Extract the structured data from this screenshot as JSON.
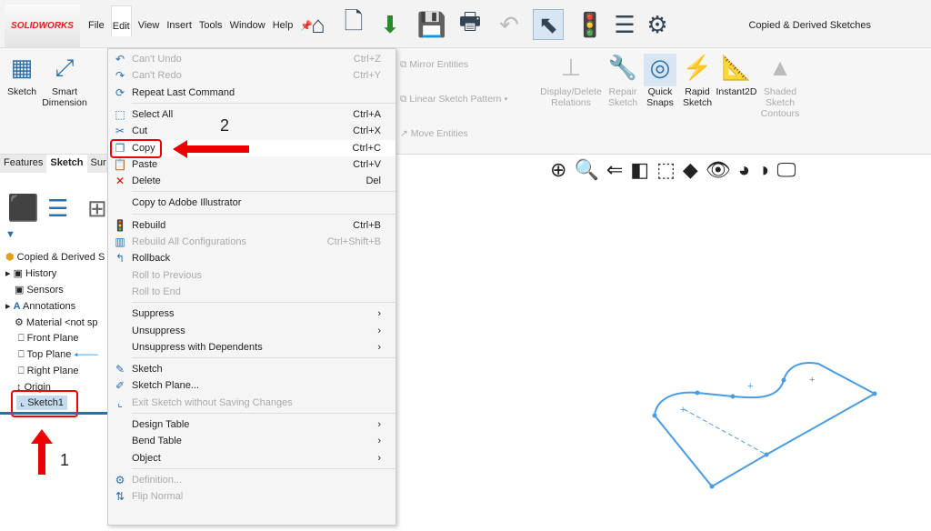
{
  "app": {
    "logo": "SOLIDWORKS",
    "document_title": "Copied & Derived Sketches"
  },
  "menubar": [
    "File",
    "Edit",
    "View",
    "Insert",
    "Tools",
    "Window",
    "Help"
  ],
  "ribbon": {
    "items": [
      {
        "label": "Sketch",
        "disabled": false
      },
      {
        "label": "Smart Dimension",
        "disabled": false
      },
      {
        "label": "Mirror Entities",
        "disabled": true
      },
      {
        "label": "Linear Sketch Pattern",
        "disabled": true
      },
      {
        "label": "Move Entities",
        "disabled": true
      },
      {
        "label": "Display/Delete Relations",
        "disabled": true
      },
      {
        "label": "Repair Sketch",
        "disabled": true
      },
      {
        "label": "Quick Snaps",
        "disabled": false
      },
      {
        "label": "Rapid Sketch",
        "disabled": false
      },
      {
        "label": "Instant2D",
        "disabled": false
      },
      {
        "label": "Shaded Sketch Contours",
        "disabled": true
      }
    ]
  },
  "tabs": [
    "Features",
    "Sketch",
    "Sur"
  ],
  "tree": {
    "root": "Copied & Derived S",
    "items": [
      "History",
      "Sensors",
      "Annotations",
      "Material <not sp",
      "Front Plane",
      "Top Plane",
      "Right Plane",
      "Origin",
      "Sketch1"
    ]
  },
  "edit_menu": [
    {
      "label": "Can't Undo",
      "shortcut": "Ctrl+Z",
      "disabled": true,
      "icon": "undo"
    },
    {
      "label": "Can't Redo",
      "shortcut": "Ctrl+Y",
      "disabled": true,
      "icon": "redo"
    },
    {
      "label": "Repeat Last Command",
      "shortcut": "",
      "disabled": false,
      "icon": "repeat"
    },
    {
      "label": "Select All",
      "shortcut": "Ctrl+A",
      "disabled": false,
      "icon": "select"
    },
    {
      "label": "Cut",
      "shortcut": "Ctrl+X",
      "disabled": false,
      "icon": "scissors"
    },
    {
      "label": "Copy",
      "shortcut": "Ctrl+C",
      "disabled": false,
      "icon": "copy"
    },
    {
      "label": "Paste",
      "shortcut": "Ctrl+V",
      "disabled": false,
      "icon": "paste"
    },
    {
      "label": "Delete",
      "shortcut": "Del",
      "disabled": false,
      "icon": "delete"
    },
    {
      "label": "Copy to Adobe Illustrator",
      "shortcut": "",
      "disabled": false,
      "icon": ""
    },
    {
      "label": "Rebuild",
      "shortcut": "Ctrl+B",
      "disabled": false,
      "icon": "traffic-light"
    },
    {
      "label": "Rebuild All Configurations",
      "shortcut": "Ctrl+Shift+B",
      "disabled": true,
      "icon": "rebuild-all"
    },
    {
      "label": "Rollback",
      "shortcut": "",
      "disabled": false,
      "icon": "rollback"
    },
    {
      "label": "Roll to Previous",
      "shortcut": "",
      "disabled": true,
      "icon": ""
    },
    {
      "label": "Roll to End",
      "shortcut": "",
      "disabled": true,
      "icon": ""
    },
    {
      "label": "Suppress",
      "shortcut": "›",
      "disabled": false,
      "icon": ""
    },
    {
      "label": "Unsuppress",
      "shortcut": "›",
      "disabled": false,
      "icon": ""
    },
    {
      "label": "Unsuppress with Dependents",
      "shortcut": "›",
      "disabled": false,
      "icon": ""
    },
    {
      "label": "Sketch",
      "shortcut": "",
      "disabled": false,
      "icon": "sketch"
    },
    {
      "label": "Sketch Plane...",
      "shortcut": "",
      "disabled": false,
      "icon": "sketch-plane"
    },
    {
      "label": "Exit Sketch without Saving Changes",
      "shortcut": "",
      "disabled": true,
      "icon": "exit-sketch"
    },
    {
      "label": "Design Table",
      "shortcut": "›",
      "disabled": false,
      "icon": ""
    },
    {
      "label": "Bend Table",
      "shortcut": "›",
      "disabled": false,
      "icon": ""
    },
    {
      "label": "Object",
      "shortcut": "›",
      "disabled": false,
      "icon": ""
    },
    {
      "label": "Definition...",
      "shortcut": "",
      "disabled": true,
      "icon": "definition"
    },
    {
      "label": "Flip Normal",
      "shortcut": "",
      "disabled": true,
      "icon": "flip"
    }
  ],
  "annotations": {
    "step1": "1",
    "step2": "2"
  },
  "colors": {
    "highlight": "#e00000",
    "sketch": "#4a9be0"
  }
}
